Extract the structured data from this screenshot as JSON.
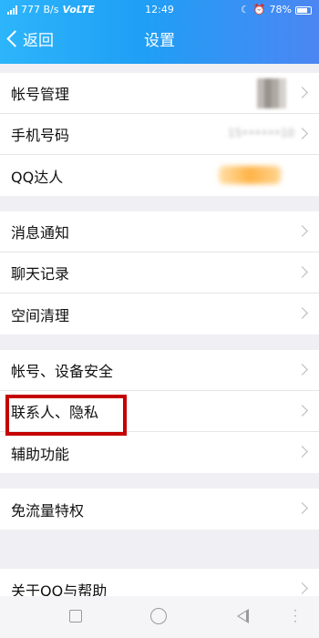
{
  "status_bar": {
    "network_speed": "777 B/s",
    "volte": "VoLTE",
    "time": "12:49",
    "battery": "78%"
  },
  "nav": {
    "back_label": "返回",
    "title": "设置"
  },
  "sections": [
    {
      "items": [
        {
          "label": "帐号管理"
        },
        {
          "label": "手机号码",
          "value": "15••••••10"
        },
        {
          "label": "QQ达人"
        }
      ]
    },
    {
      "items": [
        {
          "label": "消息通知"
        },
        {
          "label": "聊天记录"
        },
        {
          "label": "空间清理"
        }
      ]
    },
    {
      "items": [
        {
          "label": "帐号、设备安全"
        },
        {
          "label": "联系人、隐私"
        },
        {
          "label": "辅助功能"
        }
      ]
    },
    {
      "items": [
        {
          "label": "免流量特权"
        }
      ]
    },
    {
      "items": [
        {
          "label": "关于QQ与帮助"
        }
      ]
    }
  ],
  "colors": {
    "header_start": "#2db5fb",
    "header_end": "#4c86f3",
    "highlight": "#c40000"
  },
  "icons": {
    "back": "chevron-left-icon",
    "row": "chevron-right-icon",
    "system_nav": [
      "square-icon",
      "circle-icon",
      "triangle-back-icon",
      "more-dots-icon"
    ]
  }
}
